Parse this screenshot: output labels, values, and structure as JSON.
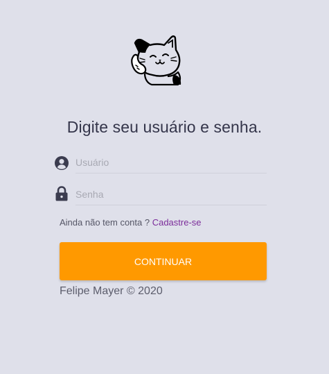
{
  "login": {
    "heading": "Digite seu usuário e senha.",
    "username_placeholder": "Usuário",
    "password_placeholder": "Senha",
    "signup_prompt": "Ainda não tem conta ? ",
    "signup_link": "Cadastre-se",
    "continue_label": "CONTINUAR"
  },
  "footer": {
    "copyright": "Felipe Mayer © 2020"
  },
  "colors": {
    "background": "#dfe0ea",
    "accent": "#ff9900",
    "link": "#7b2c9a",
    "text": "#34354a"
  },
  "icons": {
    "logo": "cat-logo-icon",
    "username": "user-circle-icon",
    "password": "lock-icon"
  }
}
